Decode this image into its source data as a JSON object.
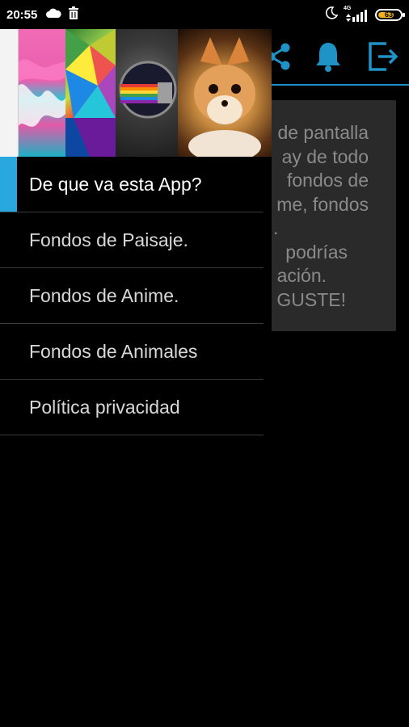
{
  "status_bar": {
    "time": "20:55",
    "network": "4G",
    "battery": "63",
    "left_icons": [
      "cloud-icon",
      "trash-icon"
    ],
    "right_icons": [
      "moon-icon",
      "signal-icon",
      "battery-icon"
    ]
  },
  "app_bar": {
    "icons": [
      "share-icon",
      "bell-icon",
      "exit-icon"
    ],
    "accent_color": "#1b8fc4"
  },
  "content": {
    "lines": [
      "de pantalla",
      "ay de todo",
      "fondos de",
      "me, fondos",
      ".",
      "podrías",
      "ación.",
      "GUSTE!"
    ]
  },
  "drawer": {
    "header_images": [
      "abstract-pink-wallpaper",
      "polygon-wallpaper",
      "cat-wallpaper",
      "fox-wallpaper"
    ],
    "items": [
      {
        "label": "De que va esta App?",
        "active": true
      },
      {
        "label": "Fondos de Paisaje."
      },
      {
        "label": "Fondos de Anime."
      },
      {
        "label": "Fondos de Animales"
      },
      {
        "label": "Política privacidad"
      }
    ],
    "accent_color": "#29a8e0"
  }
}
